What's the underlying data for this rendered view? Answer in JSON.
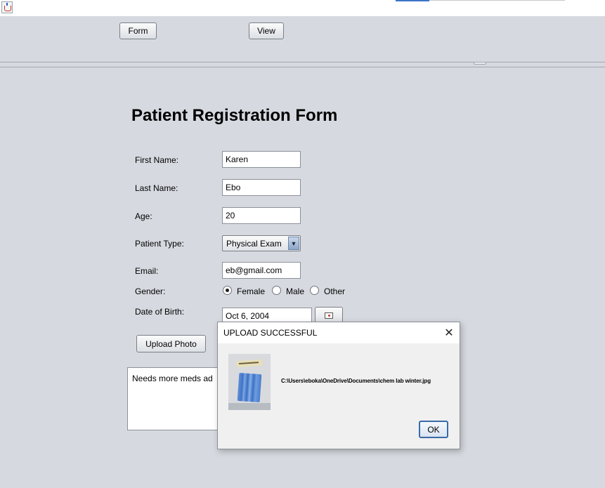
{
  "toolbar": {
    "form_label": "Form",
    "view_label": "View"
  },
  "form": {
    "title": "Patient Registration Form",
    "first_name_label": "First Name:",
    "first_name_value": "Karen",
    "last_name_label": "Last Name:",
    "last_name_value": "Ebo",
    "age_label": "Age:",
    "age_value": "20",
    "patient_type_label": "Patient Type:",
    "patient_type_value": "Physical Exam",
    "email_label": "Email:",
    "email_value": "eb@gmail.com",
    "gender_label": "Gender:",
    "gender_options": [
      "Female",
      "Male",
      "Other"
    ],
    "gender_selected": "Female",
    "dob_label": "Date of Birth:",
    "dob_value": "Oct 6, 2004",
    "upload_label": "Upload Photo",
    "notes_value": "Needs more meds ad"
  },
  "dialog": {
    "title": "UPLOAD SUCCESSFUL",
    "close_glyph": "✕",
    "path_text": "C:\\Users\\eboka\\OneDrive\\Documents\\chem lab winter.jpg",
    "ok_label": "OK"
  },
  "icons": {
    "app": "java-cup-icon",
    "dropdown": "chevron-down-icon",
    "calendar": "calendar-icon",
    "close": "close-icon"
  },
  "colors": {
    "background": "#d6d9df",
    "dialog_ok_border": "#3a6aa8",
    "dropdown_arrow": "#8ea7c9"
  }
}
